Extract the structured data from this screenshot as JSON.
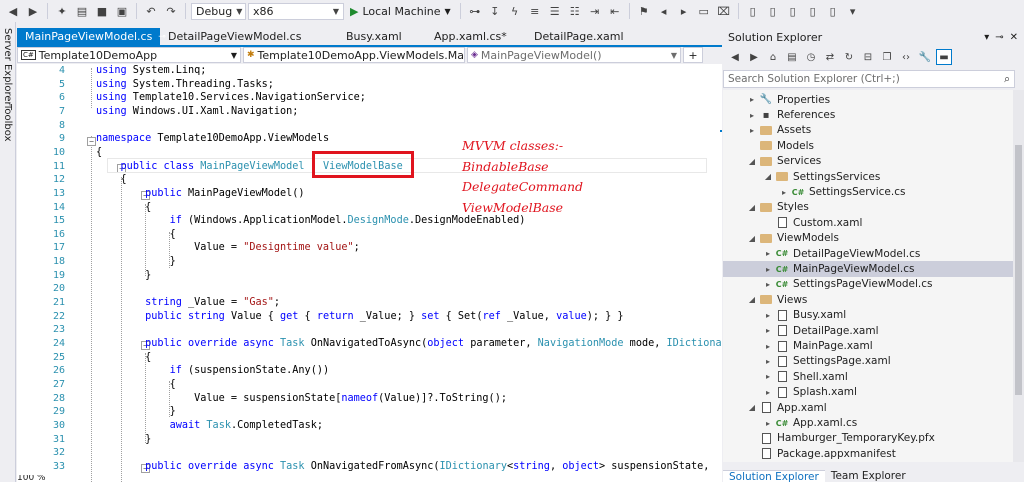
{
  "toolbar": {
    "config": "Debug",
    "platform": "x86",
    "run_label": "Local Machine"
  },
  "left_tabs": [
    "Server Explorer",
    "Toolbox"
  ],
  "doc_tabs": [
    {
      "label": "MainPageViewModel.cs",
      "active": true
    },
    {
      "label": "DetailPageViewModel.cs",
      "active": false
    },
    {
      "label": "Busy.xaml",
      "active": false
    },
    {
      "label": "App.xaml.cs*",
      "active": false
    },
    {
      "label": "DetailPage.xaml",
      "active": false
    }
  ],
  "navbar": {
    "project": "Template10DemoApp",
    "type": "Template10DemoApp.ViewModels.MainPage",
    "member": "MainPageViewModel()"
  },
  "code": {
    "line_numbers": [
      "4",
      "5",
      "6",
      "7",
      "8",
      "9",
      "10",
      "11",
      "12",
      "13",
      "14",
      "15",
      "16",
      "17",
      "18",
      "19",
      "20",
      "21",
      "22",
      "23",
      "24",
      "25",
      "26",
      "27",
      "28",
      "29",
      "30",
      "31",
      "32",
      "33"
    ]
  },
  "annotation": {
    "title": "MVVM classes:-",
    "items": [
      "BindableBase",
      "DelegateCommand",
      "ViewModelBase"
    ]
  },
  "solution_explorer": {
    "title": "Solution Explorer",
    "search_placeholder": "Search Solution Explorer (Ctrl+;)",
    "tree": [
      {
        "label": "Properties",
        "level": 1,
        "icon": "wrench",
        "arrow": "▸"
      },
      {
        "label": "References",
        "level": 1,
        "icon": "ref",
        "arrow": "▸"
      },
      {
        "label": "Assets",
        "level": 1,
        "icon": "folder",
        "arrow": "▸"
      },
      {
        "label": "Models",
        "level": 1,
        "icon": "folder",
        "arrow": ""
      },
      {
        "label": "Services",
        "level": 1,
        "icon": "folder",
        "arrow": "◢"
      },
      {
        "label": "SettingsServices",
        "level": 2,
        "icon": "folder",
        "arrow": "◢"
      },
      {
        "label": "SettingsService.cs",
        "level": 3,
        "icon": "cs",
        "arrow": "▸"
      },
      {
        "label": "Styles",
        "level": 1,
        "icon": "folder",
        "arrow": "◢"
      },
      {
        "label": "Custom.xaml",
        "level": 2,
        "icon": "file",
        "arrow": ""
      },
      {
        "label": "ViewModels",
        "level": 1,
        "icon": "folder",
        "arrow": "◢"
      },
      {
        "label": "DetailPageViewModel.cs",
        "level": 2,
        "icon": "cs",
        "arrow": "▸"
      },
      {
        "label": "MainPageViewModel.cs",
        "level": 2,
        "icon": "cs",
        "arrow": "▸",
        "selected": true
      },
      {
        "label": "SettingsPageViewModel.cs",
        "level": 2,
        "icon": "cs",
        "arrow": "▸"
      },
      {
        "label": "Views",
        "level": 1,
        "icon": "folder",
        "arrow": "◢"
      },
      {
        "label": "Busy.xaml",
        "level": 2,
        "icon": "file",
        "arrow": "▸"
      },
      {
        "label": "DetailPage.xaml",
        "level": 2,
        "icon": "file",
        "arrow": "▸"
      },
      {
        "label": "MainPage.xaml",
        "level": 2,
        "icon": "file",
        "arrow": "▸"
      },
      {
        "label": "SettingsPage.xaml",
        "level": 2,
        "icon": "file",
        "arrow": "▸"
      },
      {
        "label": "Shell.xaml",
        "level": 2,
        "icon": "file",
        "arrow": "▸"
      },
      {
        "label": "Splash.xaml",
        "level": 2,
        "icon": "file",
        "arrow": "▸"
      },
      {
        "label": "App.xaml",
        "level": 1,
        "icon": "file",
        "arrow": "◢"
      },
      {
        "label": "App.xaml.cs",
        "level": 2,
        "icon": "cs",
        "arrow": "▸"
      },
      {
        "label": "Hamburger_TemporaryKey.pfx",
        "level": 1,
        "icon": "file",
        "arrow": ""
      },
      {
        "label": "Package.appxmanifest",
        "level": 1,
        "icon": "file",
        "arrow": ""
      }
    ],
    "bottom_tabs": [
      "Solution Explorer",
      "Team Explorer"
    ]
  },
  "zoom": "100 %"
}
